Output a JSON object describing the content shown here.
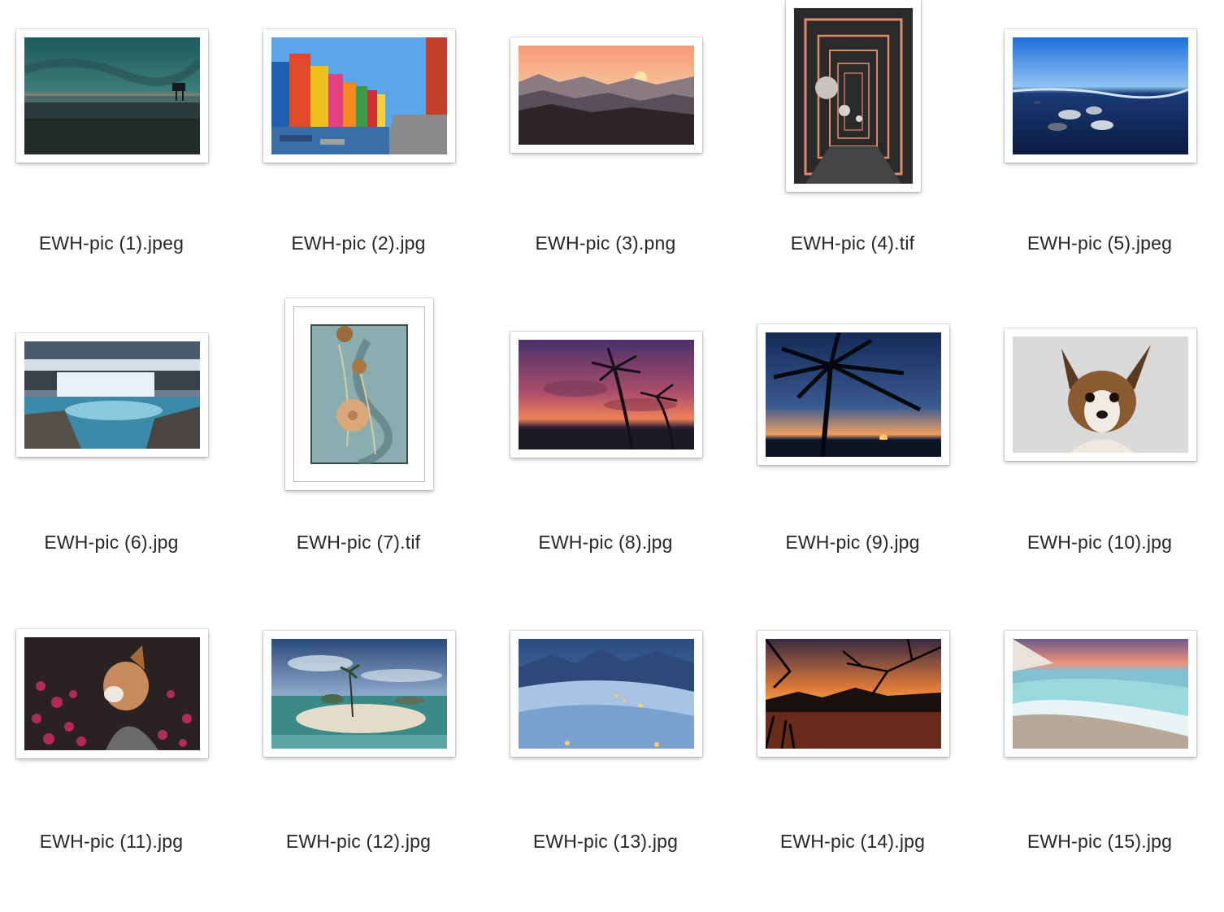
{
  "files": [
    {
      "name": "EWH-pic (1).jpeg",
      "preview": "beach-sunset-lifeguard-tower"
    },
    {
      "name": "EWH-pic (2).jpg",
      "preview": "colorful-canal-houses"
    },
    {
      "name": "EWH-pic (3).png",
      "preview": "misty-mountains-sunset"
    },
    {
      "name": "EWH-pic (4).tif",
      "preview": "neon-corridor-spheres"
    },
    {
      "name": "EWH-pic (5).jpeg",
      "preview": "blue-beach-stones"
    },
    {
      "name": "EWH-pic (6).jpg",
      "preview": "waterfall-canyon"
    },
    {
      "name": "EWH-pic (7).tif",
      "preview": "lotus-pods-framed-art"
    },
    {
      "name": "EWH-pic (8).jpg",
      "preview": "palm-trees-purple-sunset"
    },
    {
      "name": "EWH-pic (9).jpg",
      "preview": "palm-silhouette-dusk"
    },
    {
      "name": "EWH-pic (10).jpg",
      "preview": "chihuahua-portrait"
    },
    {
      "name": "EWH-pic (11).jpg",
      "preview": "dog-in-pink-flowers"
    },
    {
      "name": "EWH-pic (12).jpg",
      "preview": "tropical-sandbar-island"
    },
    {
      "name": "EWH-pic (13).jpg",
      "preview": "foggy-blue-mountains"
    },
    {
      "name": "EWH-pic (14).jpg",
      "preview": "sunset-branches-silhouette"
    },
    {
      "name": "EWH-pic (15).jpg",
      "preview": "pastel-beach-shore"
    }
  ]
}
